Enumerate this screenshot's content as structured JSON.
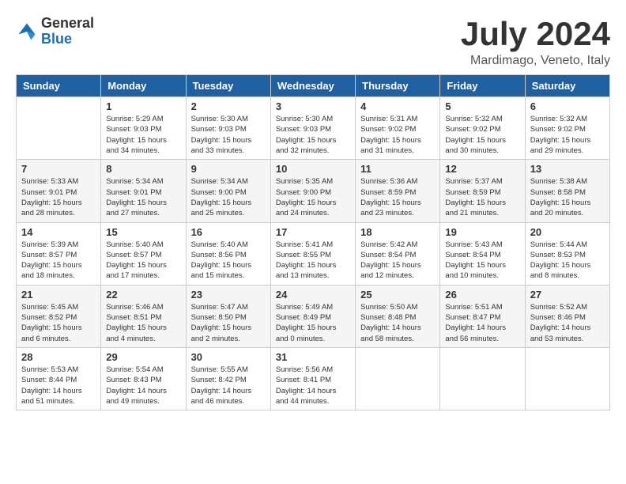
{
  "header": {
    "logo_general": "General",
    "logo_blue": "Blue",
    "month_title": "July 2024",
    "location": "Mardimago, Veneto, Italy"
  },
  "weekdays": [
    "Sunday",
    "Monday",
    "Tuesday",
    "Wednesday",
    "Thursday",
    "Friday",
    "Saturday"
  ],
  "weeks": [
    [
      {
        "day": "",
        "info": ""
      },
      {
        "day": "1",
        "info": "Sunrise: 5:29 AM\nSunset: 9:03 PM\nDaylight: 15 hours\nand 34 minutes."
      },
      {
        "day": "2",
        "info": "Sunrise: 5:30 AM\nSunset: 9:03 PM\nDaylight: 15 hours\nand 33 minutes."
      },
      {
        "day": "3",
        "info": "Sunrise: 5:30 AM\nSunset: 9:03 PM\nDaylight: 15 hours\nand 32 minutes."
      },
      {
        "day": "4",
        "info": "Sunrise: 5:31 AM\nSunset: 9:02 PM\nDaylight: 15 hours\nand 31 minutes."
      },
      {
        "day": "5",
        "info": "Sunrise: 5:32 AM\nSunset: 9:02 PM\nDaylight: 15 hours\nand 30 minutes."
      },
      {
        "day": "6",
        "info": "Sunrise: 5:32 AM\nSunset: 9:02 PM\nDaylight: 15 hours\nand 29 minutes."
      }
    ],
    [
      {
        "day": "7",
        "info": "Sunrise: 5:33 AM\nSunset: 9:01 PM\nDaylight: 15 hours\nand 28 minutes."
      },
      {
        "day": "8",
        "info": "Sunrise: 5:34 AM\nSunset: 9:01 PM\nDaylight: 15 hours\nand 27 minutes."
      },
      {
        "day": "9",
        "info": "Sunrise: 5:34 AM\nSunset: 9:00 PM\nDaylight: 15 hours\nand 25 minutes."
      },
      {
        "day": "10",
        "info": "Sunrise: 5:35 AM\nSunset: 9:00 PM\nDaylight: 15 hours\nand 24 minutes."
      },
      {
        "day": "11",
        "info": "Sunrise: 5:36 AM\nSunset: 8:59 PM\nDaylight: 15 hours\nand 23 minutes."
      },
      {
        "day": "12",
        "info": "Sunrise: 5:37 AM\nSunset: 8:59 PM\nDaylight: 15 hours\nand 21 minutes."
      },
      {
        "day": "13",
        "info": "Sunrise: 5:38 AM\nSunset: 8:58 PM\nDaylight: 15 hours\nand 20 minutes."
      }
    ],
    [
      {
        "day": "14",
        "info": "Sunrise: 5:39 AM\nSunset: 8:57 PM\nDaylight: 15 hours\nand 18 minutes."
      },
      {
        "day": "15",
        "info": "Sunrise: 5:40 AM\nSunset: 8:57 PM\nDaylight: 15 hours\nand 17 minutes."
      },
      {
        "day": "16",
        "info": "Sunrise: 5:40 AM\nSunset: 8:56 PM\nDaylight: 15 hours\nand 15 minutes."
      },
      {
        "day": "17",
        "info": "Sunrise: 5:41 AM\nSunset: 8:55 PM\nDaylight: 15 hours\nand 13 minutes."
      },
      {
        "day": "18",
        "info": "Sunrise: 5:42 AM\nSunset: 8:54 PM\nDaylight: 15 hours\nand 12 minutes."
      },
      {
        "day": "19",
        "info": "Sunrise: 5:43 AM\nSunset: 8:54 PM\nDaylight: 15 hours\nand 10 minutes."
      },
      {
        "day": "20",
        "info": "Sunrise: 5:44 AM\nSunset: 8:53 PM\nDaylight: 15 hours\nand 8 minutes."
      }
    ],
    [
      {
        "day": "21",
        "info": "Sunrise: 5:45 AM\nSunset: 8:52 PM\nDaylight: 15 hours\nand 6 minutes."
      },
      {
        "day": "22",
        "info": "Sunrise: 5:46 AM\nSunset: 8:51 PM\nDaylight: 15 hours\nand 4 minutes."
      },
      {
        "day": "23",
        "info": "Sunrise: 5:47 AM\nSunset: 8:50 PM\nDaylight: 15 hours\nand 2 minutes."
      },
      {
        "day": "24",
        "info": "Sunrise: 5:49 AM\nSunset: 8:49 PM\nDaylight: 15 hours\nand 0 minutes."
      },
      {
        "day": "25",
        "info": "Sunrise: 5:50 AM\nSunset: 8:48 PM\nDaylight: 14 hours\nand 58 minutes."
      },
      {
        "day": "26",
        "info": "Sunrise: 5:51 AM\nSunset: 8:47 PM\nDaylight: 14 hours\nand 56 minutes."
      },
      {
        "day": "27",
        "info": "Sunrise: 5:52 AM\nSunset: 8:46 PM\nDaylight: 14 hours\nand 53 minutes."
      }
    ],
    [
      {
        "day": "28",
        "info": "Sunrise: 5:53 AM\nSunset: 8:44 PM\nDaylight: 14 hours\nand 51 minutes."
      },
      {
        "day": "29",
        "info": "Sunrise: 5:54 AM\nSunset: 8:43 PM\nDaylight: 14 hours\nand 49 minutes."
      },
      {
        "day": "30",
        "info": "Sunrise: 5:55 AM\nSunset: 8:42 PM\nDaylight: 14 hours\nand 46 minutes."
      },
      {
        "day": "31",
        "info": "Sunrise: 5:56 AM\nSunset: 8:41 PM\nDaylight: 14 hours\nand 44 minutes."
      },
      {
        "day": "",
        "info": ""
      },
      {
        "day": "",
        "info": ""
      },
      {
        "day": "",
        "info": ""
      }
    ]
  ]
}
